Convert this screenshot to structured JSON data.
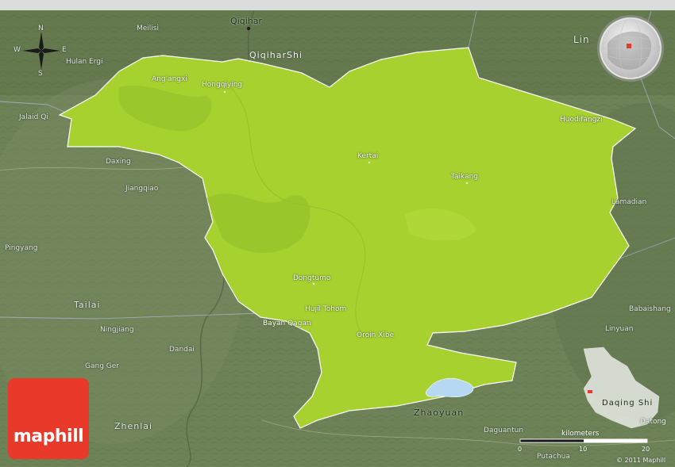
{
  "brand": {
    "name": "maphill",
    "logo_color": "#e8392b"
  },
  "colors": {
    "region_fill": "#a6d12f",
    "region_stroke": "#ffffff",
    "terrain_base": "#6d8257",
    "lake": "#b6d8f2"
  },
  "compass": {
    "n": "N",
    "s": "S",
    "w": "W",
    "e": "E"
  },
  "labels_outside": {
    "qiqihar": "Qiqihar",
    "meilisi": "Meilisi",
    "hulan_ergi": "Hulan Ergi",
    "jalaid_qi": "Jalaid Qi",
    "daxing": "Daxing",
    "jianggiao": "Jiangqiao",
    "pingyang": "Pingyang",
    "ningjiang": "Ningjiang",
    "dandai": "Dandai",
    "gang_ger": "Gang Ger",
    "lamadian": "Lamadian",
    "babaishang": "Babaishang",
    "linyuan": "Linyuan",
    "daguantun": "Daguantun",
    "putachua": "Putachua",
    "datong": "Datong"
  },
  "labels_large": {
    "qiqihar_shi": "QiqiharShi",
    "lin": "Lin",
    "tailai": "Tailai",
    "zhenlai": "Zhenlai",
    "zhaoyuan": "Zhaoyuan",
    "daqing_shi": "Daqing Shi"
  },
  "labels_inside": {
    "angangxi": "Ang'angxi",
    "hongqiying": "Hongqiying",
    "huodifangzi": "Huodifangzi",
    "kertai": "Kertai",
    "taikang": "Taikang",
    "dongtumo": "Dongtumo",
    "hujil_tohom": "Hujil Tohom",
    "bayan_qagan": "Bayan Qagan",
    "oroin_xibe": "Oroin Xibe"
  },
  "scale": {
    "title": "kilometers",
    "ticks": [
      "0",
      "10",
      "20"
    ]
  },
  "copyright": "© 2011 Maphill"
}
